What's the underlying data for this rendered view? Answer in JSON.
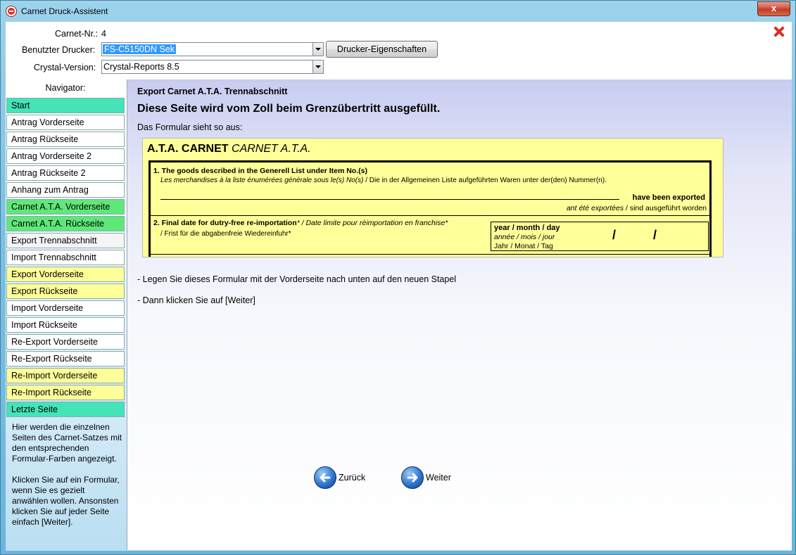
{
  "window": {
    "title": "Carnet Druck-Assistent",
    "close_label": "x"
  },
  "header": {
    "carnet_label": "Carnet-Nr.:",
    "carnet_value": "4",
    "printer_label": "Benutzter Drucker:",
    "printer_value": "FS-C5150DN Sek",
    "printer_props_button": "Drucker-Eigenschaften",
    "crystal_label": "Crystal-Version:",
    "crystal_value": "Crystal-Reports 8.5"
  },
  "navigator": {
    "title": "Navigator:",
    "items": [
      {
        "label": "Start",
        "color": "#44e4b8"
      },
      {
        "label": "Antrag Vorderseite",
        "color": "#ffffff"
      },
      {
        "label": "Antrag Rückseite",
        "color": "#ffffff"
      },
      {
        "label": "Antrag Vorderseite 2",
        "color": "#ffffff"
      },
      {
        "label": "Antrag Rückseite 2",
        "color": "#ffffff"
      },
      {
        "label": "Anhang zum Antrag",
        "color": "#ffffff"
      },
      {
        "label": "Carnet A.T.A. Vorderseite",
        "color": "#5fe87a"
      },
      {
        "label": "Carnet A.T.A. Rückseite",
        "color": "#5fe87a"
      },
      {
        "label": "Export Trennabschnitt",
        "color": "#f5f5f5"
      },
      {
        "label": "Import Trennabschnitt",
        "color": "#ffffff"
      },
      {
        "label": "Export Vorderseite",
        "color": "#ffff99"
      },
      {
        "label": "Export Rückseite",
        "color": "#ffff99"
      },
      {
        "label": "Import Vorderseite",
        "color": "#ffffff"
      },
      {
        "label": "Import Rückseite",
        "color": "#ffffff"
      },
      {
        "label": "Re-Export Vorderseite",
        "color": "#ffffff"
      },
      {
        "label": "Re-Export Rückseite",
        "color": "#ffffff"
      },
      {
        "label": "Re-Import Vorderseite",
        "color": "#ffff99"
      },
      {
        "label": "Re-Import Rückseite",
        "color": "#ffff99"
      },
      {
        "label": "Letzte Seite",
        "color": "#44e4b8"
      }
    ],
    "help_p1": "Hier werden die einzelnen Seiten des Carnet-Satzes mit den entsprechenden Formular-Farben angezeigt.",
    "help_p2": "Klicken Sie auf ein Formular, wenn Sie es gezielt anwählen wollen. Ansonsten klicken Sie auf jeder Seite einfach [Weiter]."
  },
  "main": {
    "subtitle": "Export Carnet A.T.A. Trennabschnitt",
    "heading": "Diese Seite wird vom Zoll beim Grenzübertritt ausgefüllt.",
    "intro": "Das Formular sieht so aus:",
    "instruction1": "- Legen Sie dieses Formular mit der Vorderseite nach unten auf den neuen Stapel",
    "instruction2": "- Dann klicken Sie auf [Weiter]",
    "back_label": "Zurück",
    "next_label": "Weiter"
  },
  "form": {
    "title_bold": "A.T.A. CARNET",
    "title_italic": "CARNET A.T.A.",
    "f1_title": "1. The goods described in the Generell List under Item No.(s)",
    "f1_sub_italic": "Les merchandises à la liste énumérées générale sous le(s) No(s)",
    "f1_sub_plain": " / Die in der Allgemeinen Liste aufgeführten Waren unter der(den) Nummer(n).",
    "f1_exported": "have been exported",
    "f1_exported2_italic": "ant été exportées",
    "f1_exported2_plain": " / sind ausgeführt worden",
    "f2_title_bold": "2. Final date for dutry-free re-importation",
    "f2_title_italic": "* / Date limite pour réimportation en franchise*",
    "f2_sub": "/ Frist für die abgabenfreie Wiedereinfuhr*",
    "date_l1": "year / month / day",
    "date_l2": "année / mois / jour",
    "date_l3": "Jahr / Monat / Tag",
    "slash": "/"
  }
}
